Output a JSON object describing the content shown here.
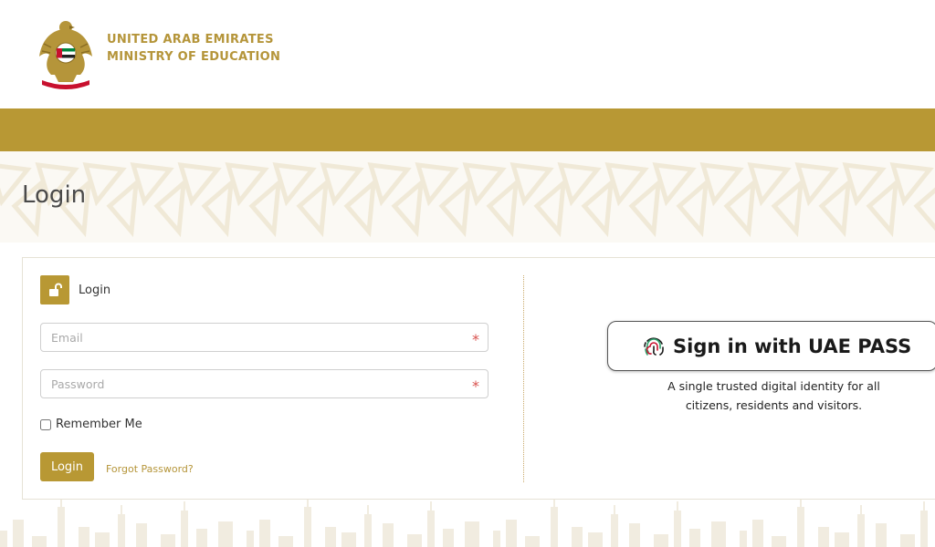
{
  "header": {
    "country": "UNITED ARAB EMIRATES",
    "ministry": "MINISTRY OF EDUCATION",
    "emblem_icon": "uae-emblem-icon"
  },
  "page": {
    "title": "Login"
  },
  "login_form": {
    "heading": "Login",
    "heading_icon": "unlock-icon",
    "email_placeholder": "Email",
    "password_placeholder": "Password",
    "required_mark": "*",
    "remember_label": "Remember Me",
    "remember_checked": false,
    "submit_label": "Login",
    "forgot_label": "Forgot Password?"
  },
  "uae_pass": {
    "button_label": "Sign in with UAE PASS",
    "icon": "fingerprint-icon",
    "description_line1": "A single trusted digital identity for all",
    "description_line2": "citizens, residents and visitors."
  },
  "colors": {
    "accent": "#b89834",
    "accent_text": "#b5953a",
    "required": "#d9534f"
  }
}
